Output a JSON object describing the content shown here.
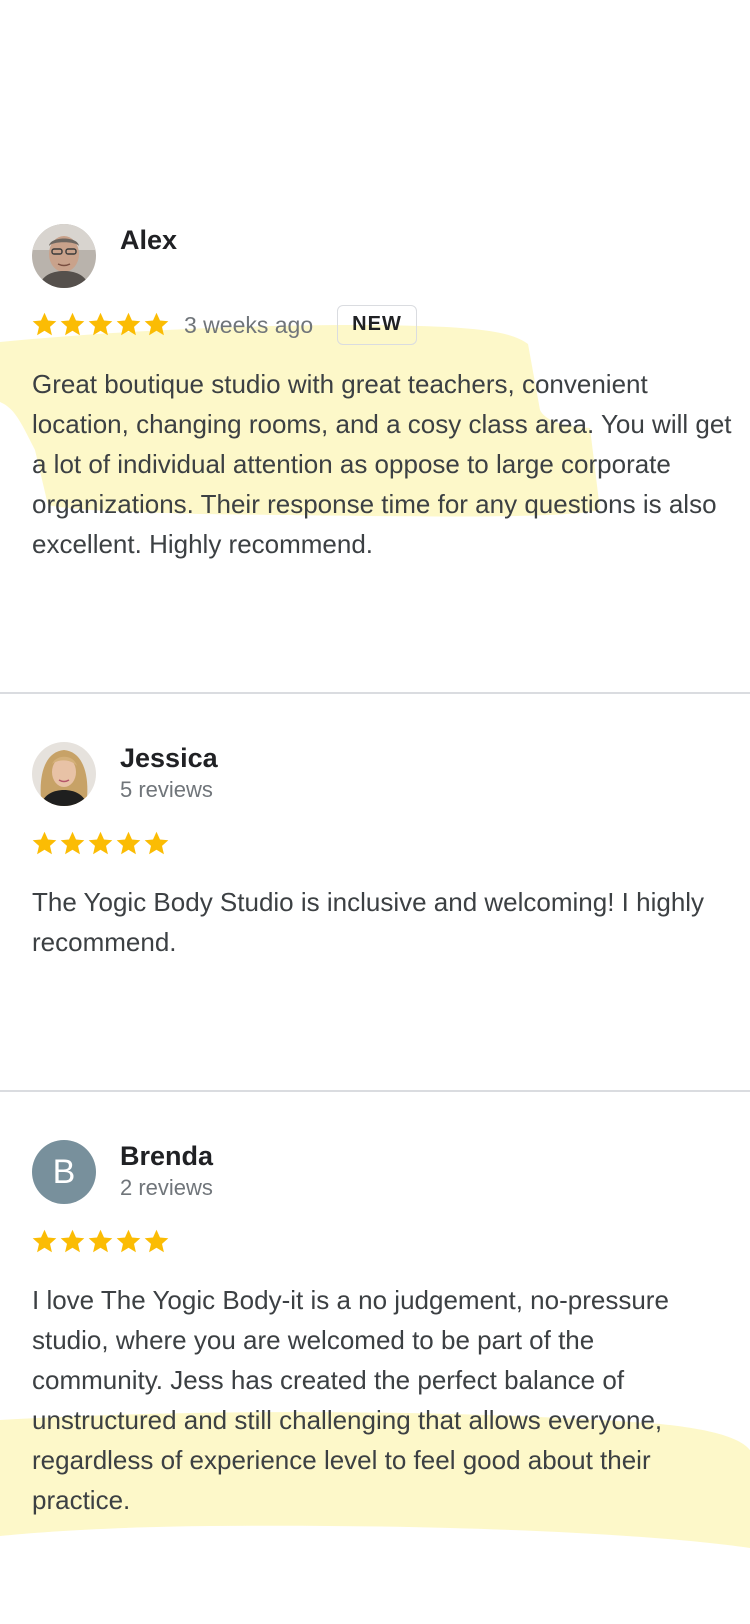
{
  "reviews": [
    {
      "name": "Alex",
      "rating": 5,
      "time_ago": "3 weeks ago",
      "badge": "NEW",
      "avatar": "photo-man-avatar",
      "text": "Great boutique studio with great teachers, convenient location, changing rooms, and a cosy class area. You will get a lot of individual attention as oppose to large corporate organizations. Their response time for any questions is also excellent. Highly recommend."
    },
    {
      "name": "Jessica",
      "meta": "5 reviews",
      "rating": 5,
      "avatar": "photo-woman-avatar",
      "text": "The Yogic Body Studio is inclusive and welcoming! I highly recommend."
    },
    {
      "name": "Brenda",
      "meta": "2 reviews",
      "rating": 5,
      "avatar_letter": "B",
      "text": "I love The Yogic Body-it is a no judgement, no-pressure studio, where you are welcomed to be part of the community. Jess has created the perfect balance of unstructured and still challenging that allows everyone, regardless of experience level to feel good about their practice."
    }
  ],
  "colors": {
    "star": "#fbbc04",
    "highlight": "#fdf7c3",
    "divider": "#dadce0",
    "letter_avatar": "#78909c"
  },
  "icons": {
    "star": "star-icon"
  }
}
